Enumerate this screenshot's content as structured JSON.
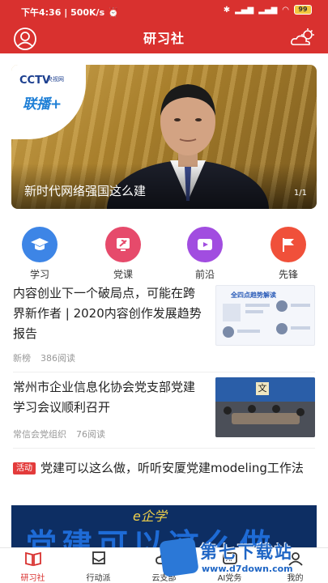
{
  "status": {
    "time": "下午4:36",
    "speed": "500K/s",
    "battery": "99"
  },
  "header": {
    "title": "研习社"
  },
  "banner": {
    "caption": "新时代网络强国这么建",
    "pager": "1/1",
    "logo_main": "CCTV",
    "logo_sub": "央视网",
    "logo_tag": "联播+"
  },
  "quick_icons": [
    {
      "label": "学习",
      "color": "#3d85e6",
      "icon": "graduation-cap-icon"
    },
    {
      "label": "党课",
      "color": "#e64a6b",
      "icon": "party-lesson-icon"
    },
    {
      "label": "前沿",
      "color": "#a14de0",
      "icon": "play-icon"
    },
    {
      "label": "先锋",
      "color": "#f0503a",
      "icon": "flag-icon"
    }
  ],
  "feed": [
    {
      "title": "内容创业下一个破局点，可能在跨界新作者 | 2020内容创作发展趋势报告",
      "source": "新榜",
      "reads": "386阅读",
      "thumb_text": "全四点趋势解读"
    },
    {
      "title": "常州市企业信息化协会党支部党建学习会议顺利召开",
      "source": "常信会党组织",
      "reads": "76阅读"
    },
    {
      "tag": "活动",
      "title": "党建可以这么做，听听安厦党建modeling工作法",
      "ad_big": "党建可以这么做",
      "ad_small": "e企学"
    }
  ],
  "bottom_nav": [
    {
      "label": "研习社",
      "icon": "book-icon",
      "active": true
    },
    {
      "label": "行动派",
      "icon": "flag-outline-icon",
      "active": false
    },
    {
      "label": "云支部",
      "icon": "cloud-icon",
      "active": false
    },
    {
      "label": "AI党务",
      "icon": "ai-icon",
      "active": false
    },
    {
      "label": "我的",
      "icon": "user-icon",
      "active": false
    }
  ],
  "watermark": {
    "text": "第七下载站",
    "url": "www.d7down.com"
  },
  "colors": {
    "brand_red": "#d9312f",
    "tag_red": "#e33b3b",
    "meta_gray": "#999999"
  }
}
